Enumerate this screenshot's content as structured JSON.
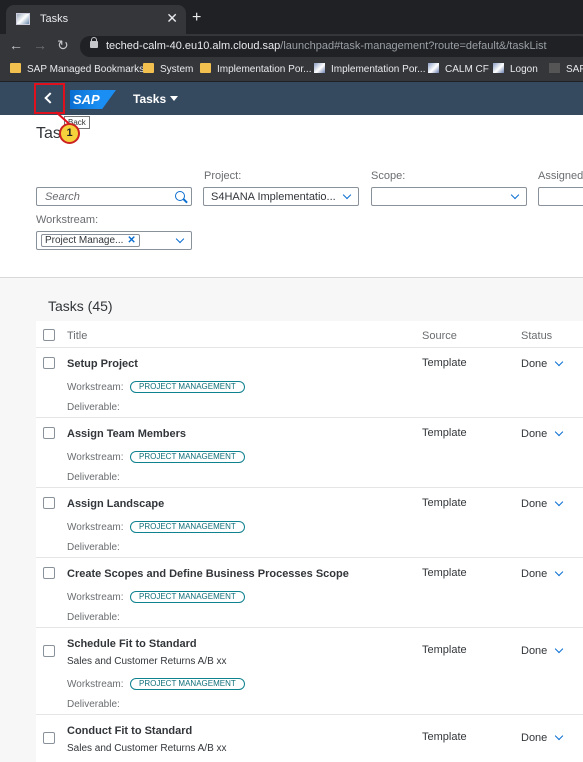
{
  "browser": {
    "tab_title": "Tasks",
    "new_tab": "+",
    "url_host": "teched-calm-40.eu10.alm.cloud.sap",
    "url_path": "/launchpad#task-management?route=default&/taskList",
    "bookmarks": [
      "SAP Managed Bookmarks",
      "System",
      "Implementation Por...",
      "Implementation Por...",
      "CALM CF",
      "Logon",
      "SAP"
    ]
  },
  "shell": {
    "logo": "SAP",
    "app_title": "Tasks",
    "back_tooltip": "Back",
    "callout_number": "1"
  },
  "header": {
    "page_title": "Tasks",
    "search_placeholder": "Search",
    "project_label": "Project:",
    "project_value": "S4HANA Implementatio...",
    "scope_label": "Scope:",
    "scope_value": "",
    "assigned_label": "Assigned",
    "workstream_label": "Workstream:",
    "workstream_token": "Project Manage..."
  },
  "table": {
    "title": "Tasks (45)",
    "columns": {
      "title": "Title",
      "source": "Source",
      "status": "Status"
    },
    "workstream_label": "Workstream:",
    "deliverable_label": "Deliverable:",
    "rows": [
      {
        "title": "Setup Project",
        "subtitle": "",
        "workstream": "PROJECT MANAGEMENT",
        "source": "Template",
        "status": "Done"
      },
      {
        "title": "Assign Team Members",
        "subtitle": "",
        "workstream": "PROJECT MANAGEMENT",
        "source": "Template",
        "status": "Done"
      },
      {
        "title": "Assign Landscape",
        "subtitle": "",
        "workstream": "PROJECT MANAGEMENT",
        "source": "Template",
        "status": "Done"
      },
      {
        "title": "Create Scopes and Define Business Processes Scope",
        "subtitle": "",
        "workstream": "PROJECT MANAGEMENT",
        "source": "Template",
        "status": "Done"
      },
      {
        "title": "Schedule Fit to Standard",
        "subtitle": "Sales and Customer Returns A/B xx",
        "workstream": "PROJECT MANAGEMENT",
        "source": "Template",
        "status": "Done"
      },
      {
        "title": "Conduct Fit to Standard",
        "subtitle": "Sales and Customer Returns A/B xx",
        "workstream": "",
        "source": "Template",
        "status": "Done"
      }
    ]
  },
  "colors": {
    "shell": "#354a5f",
    "accent": "#0a6ed1",
    "tag": "#0f828f",
    "highlight": "#e0101c"
  }
}
